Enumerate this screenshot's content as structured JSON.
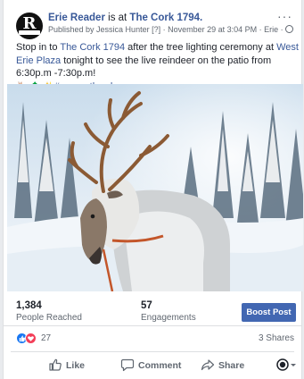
{
  "post": {
    "page_name": "Erie Reader",
    "is_at": " is at ",
    "place": "The Cork 1794.",
    "published_by": "Published by ",
    "author": "Jessica Hunter",
    "author_tag": " [?] · November 29 at 3:04 PM · Erie · ",
    "more": "···",
    "text_1": "Stop in to ",
    "text_link_1": "The Cork 1794",
    "text_2": " after the tree lighting ceremony at ",
    "text_link_2": "West Erie Plaza",
    "text_3": " tonight to see the live reindeer on the patio from 6:30p.m -7:30p.m!",
    "emoji": "🦌 🌲 ✨",
    "hashtag": "#supportlocal"
  },
  "icons": [
    "menu-dots-icon",
    "globe-icon",
    "reindeer-emoji-icon",
    "like-reaction-icon",
    "love-reaction-icon",
    "thumbs-up-icon",
    "comment-icon",
    "share-icon",
    "page-avatar-icon",
    "chevron-down-icon"
  ],
  "stats": {
    "reached_value": "1,384",
    "reached_label": "People Reached",
    "engagements_value": "57",
    "engagements_label": "Engagements",
    "boost_label": "Boost Post"
  },
  "reactions": {
    "count": "27",
    "shares": "3 Shares"
  },
  "actions": {
    "like": "Like",
    "comment": "Comment",
    "share": "Share"
  },
  "colors": {
    "link": "#385898",
    "boost": "#4267b2",
    "like": "#1877f2",
    "love": "#f33e58"
  }
}
